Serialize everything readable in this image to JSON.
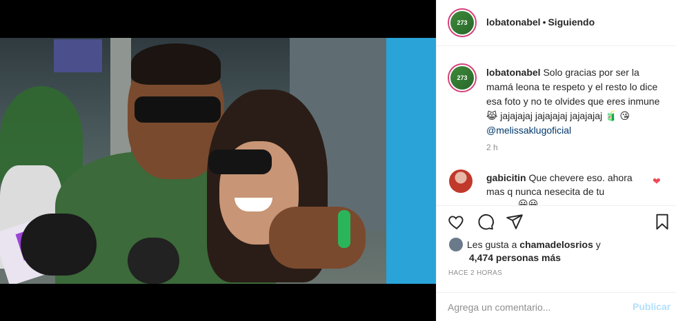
{
  "post": {
    "username": "lobatonabel",
    "separator": "•",
    "follow_status": "Siguiendo",
    "avatar_text": "273"
  },
  "caption": {
    "username": "lobatonabel",
    "text": " Solo gracias por ser la mamá leona te respeto y el resto lo dice esa foto y no te olvides que eres inmune 😹 jajajajaj jajajajaj jajajajaj 🧃 😘 ",
    "mention": "@melissaklugoficial",
    "time": "2 h"
  },
  "comments": [
    {
      "username": "gabicitin",
      "text": " Que chevere eso. ahora mas q nunca nesecita de tu",
      "peek": "😀😀"
    }
  ],
  "likes": {
    "prefix": "Les gusta a ",
    "user": "chamadelosrios",
    "mid": " y",
    "count_text": "4,474 personas más"
  },
  "timestamp": "HACE 2 HORAS",
  "add_comment": {
    "placeholder": "Agrega un comentario...",
    "publish_label": "Publicar"
  },
  "icons": [
    "heart-icon",
    "comment-icon",
    "share-icon",
    "bookmark-icon",
    "heart-small-icon"
  ],
  "colors": {
    "mention": "#00376b",
    "muted": "#8e8e8e",
    "publish_disabled": "#b2dffc",
    "like_heart": "#ed4956",
    "story_ring": "#d63f78"
  }
}
